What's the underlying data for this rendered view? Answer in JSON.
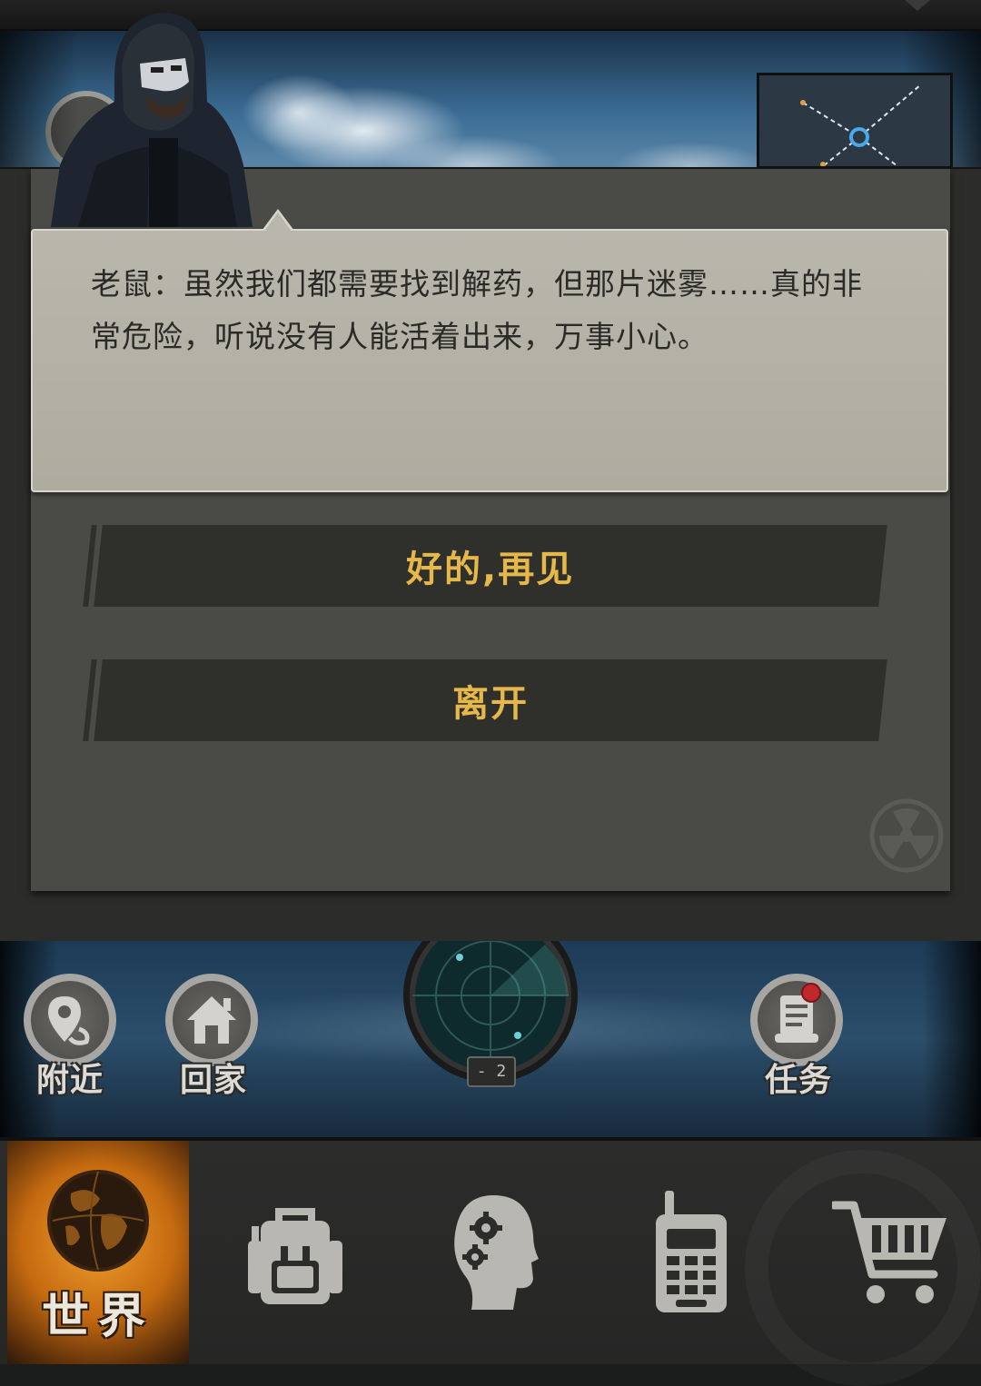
{
  "dialog": {
    "speaker_text": "老鼠：虽然我们都需要找到解药，但那片迷雾……真的非常危险，听说没有人能活着出来，万事小心。",
    "choices": [
      {
        "label": "好的,再见"
      },
      {
        "label": "离开"
      }
    ]
  },
  "map_actions": {
    "nearby": {
      "label": "附近",
      "icon": "location-pin-icon"
    },
    "home": {
      "label": "回家",
      "icon": "house-icon"
    },
    "tasks": {
      "label": "任务",
      "icon": "scroll-icon",
      "has_notification": true
    },
    "radar": {
      "level_label": "- 2",
      "icon": "radar-icon"
    }
  },
  "bottom_nav": {
    "items": [
      {
        "label": "世界",
        "icon": "globe-icon",
        "active": true
      },
      {
        "label": "",
        "icon": "backpack-icon"
      },
      {
        "label": "",
        "icon": "head-gears-icon"
      },
      {
        "label": "",
        "icon": "walkie-talkie-icon"
      },
      {
        "label": "",
        "icon": "shopping-cart-icon"
      }
    ]
  },
  "colors": {
    "choice_text": "#e6b84a",
    "speech_bg": "#b9b7ac",
    "world_tab": "#e08a20",
    "notification": "#c0282c"
  }
}
